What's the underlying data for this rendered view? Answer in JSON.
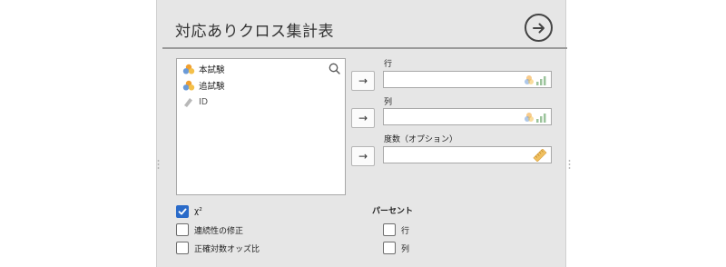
{
  "header": {
    "title": "対応ありクロス集計表",
    "run_icon": "arrow-right-circle-icon"
  },
  "variables": {
    "search_icon": "search-icon",
    "items": [
      {
        "label": "本試験",
        "icon": "nominal-icon"
      },
      {
        "label": "追試験",
        "icon": "nominal-icon"
      },
      {
        "label": "ID",
        "icon": "id-icon"
      }
    ]
  },
  "targets": {
    "arrow_label": "→",
    "rows": {
      "label": "行",
      "type_icon": "nominal-ordinal-icon"
    },
    "columns": {
      "label": "列",
      "type_icon": "nominal-ordinal-icon"
    },
    "counts": {
      "label": "度数（オプション）",
      "type_icon": "scale-ruler-icon"
    }
  },
  "options": {
    "chi2": {
      "label": "χ²",
      "checked": true
    },
    "continuity": {
      "label": "連続性の修正",
      "checked": false
    },
    "log_odds": {
      "label": "正確対数オッズ比",
      "checked": false
    }
  },
  "percentages": {
    "title": "パーセント",
    "row": {
      "label": "行",
      "checked": false
    },
    "column": {
      "label": "列",
      "checked": false
    }
  },
  "colors": {
    "accent": "#2a6bc9",
    "panel_bg": "#e6e6e6",
    "nominal_orange": "#f0a030",
    "nominal_blue": "#6b9bd8"
  }
}
